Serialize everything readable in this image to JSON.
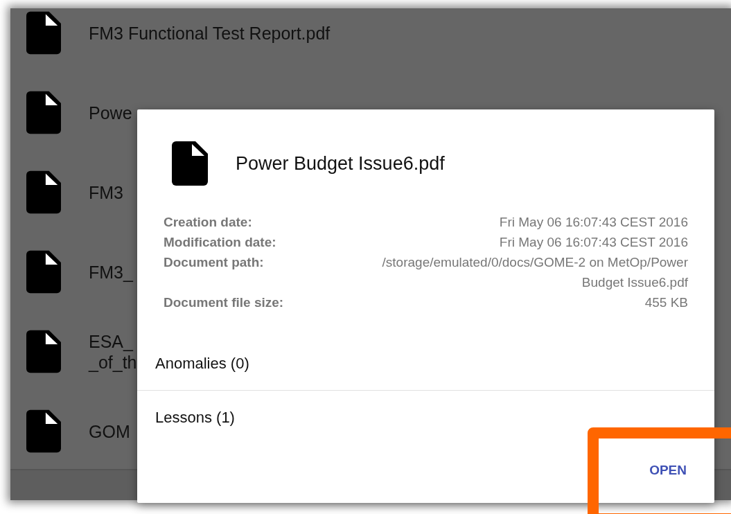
{
  "file_list": [
    {
      "lines": [
        "FM3 Functional Test Report.pdf"
      ]
    },
    {
      "lines": [
        "Powe"
      ]
    },
    {
      "lines": [
        "FM3"
      ]
    },
    {
      "lines": [
        "FM3_"
      ]
    },
    {
      "lines": [
        "ESA_",
        "_of_th"
      ]
    },
    {
      "lines": [
        "GOM"
      ]
    }
  ],
  "dialog": {
    "title": "Power Budget Issue6.pdf",
    "details": [
      {
        "label": "Creation date:",
        "value": "Fri May 06 16:07:43 CEST 2016"
      },
      {
        "label": "Modification date:",
        "value": "Fri May 06 16:07:43 CEST 2016"
      },
      {
        "label": "Document path:",
        "value": "/storage/emulated/0/docs/GOME-2 on MetOp/Power Budget Issue6.pdf"
      },
      {
        "label": "Document file size:",
        "value": "455 KB"
      }
    ],
    "sections": [
      {
        "label": "Anomalies (0)"
      },
      {
        "label": "Lessons (1)"
      }
    ],
    "action": "OPEN"
  },
  "annotation": {
    "kind": "frame"
  }
}
